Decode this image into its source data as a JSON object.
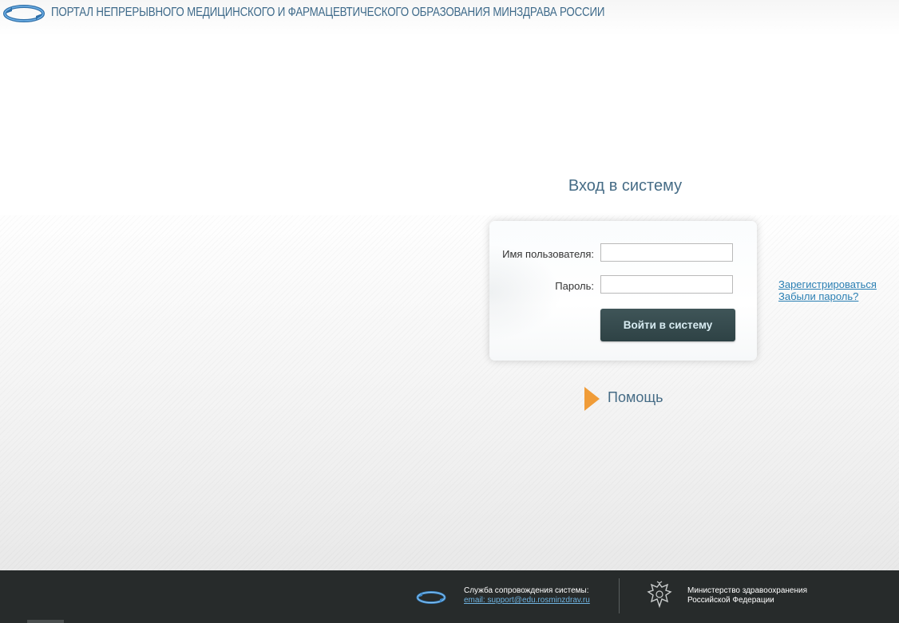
{
  "header": {
    "portal_title": "ПОРТАЛ НЕПРЕРЫВНОГО МЕДИЦИНСКОГО И ФАРМАЦЕВТИЧЕСКОГО ОБРАЗОВАНИЯ МИНЗДРАВА РОССИИ",
    "logo_icon": "portal-logo-icon"
  },
  "login": {
    "title": "Вход в систему",
    "username_label": "Имя пользователя:",
    "username_value": "",
    "password_label": "Пароль:",
    "password_value": "",
    "submit_label": "Войти в систему"
  },
  "links": {
    "register": "Зарегистрироваться",
    "forgot_password": "Забыли пароль?"
  },
  "help": {
    "label": "Помощь",
    "arrow_color": "#f09c38"
  },
  "footer": {
    "support_title": "Служба сопровождения системы:",
    "support_email": "email: support@edu.rosminzdrav.ru",
    "ministry_line1": "Министерство здравоохранения",
    "ministry_line2": "Российской Федерации",
    "emblem_icon": "double-headed-eagle-emblem-icon"
  },
  "colors": {
    "title_blue": "#466c86",
    "link_blue": "#2a7fb3",
    "button_bg": "#2e4245",
    "footer_bg": "#272b2b"
  }
}
